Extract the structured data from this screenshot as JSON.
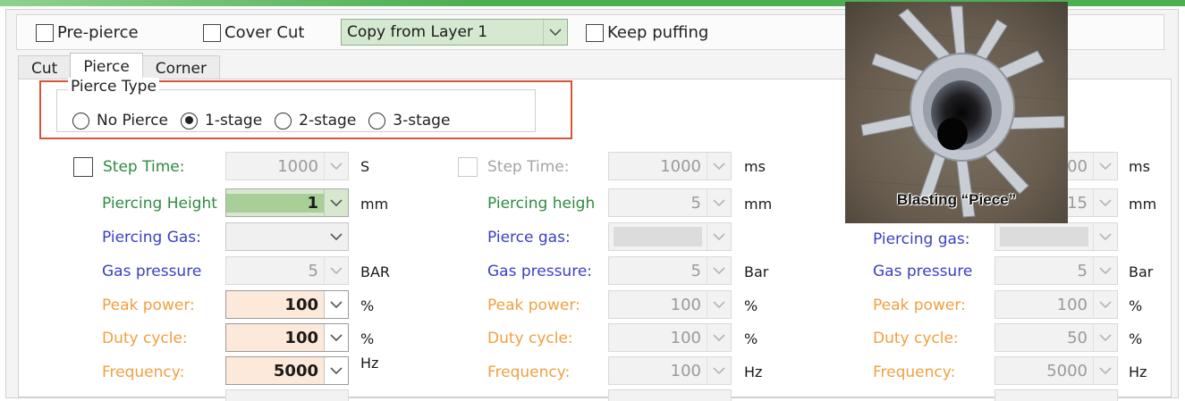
{
  "top_bar": {
    "pre_pierce_label": "Pre-pierce",
    "cover_cut_label": "Cover Cut",
    "copy_value": "Copy from Layer 1",
    "keep_puffing_label": "Keep puffing"
  },
  "tabs": [
    "Cut",
    "Pierce",
    "Corner"
  ],
  "active_tab": "Pierce",
  "pierce_type": {
    "title": "Pierce Type",
    "options": [
      "No Pierce",
      "1-stage",
      "2-stage",
      "3-stage"
    ],
    "selected": "1-stage"
  },
  "stage1": {
    "step_time": {
      "label": "Step Time:",
      "value": "1000",
      "unit": "S"
    },
    "piercing_height": {
      "label": "Piercing Height",
      "value": "1",
      "unit": "mm"
    },
    "piercing_gas": {
      "label": "Piercing Gas:",
      "value": ""
    },
    "gas_pressure": {
      "label": "Gas pressure",
      "value": "5",
      "unit": "BAR"
    },
    "peak_power": {
      "label": "Peak power:",
      "value": "100",
      "unit": "%"
    },
    "duty_cycle": {
      "label": "Duty cycle:",
      "value": "100",
      "unit": "%"
    },
    "frequency": {
      "label": "Frequency:",
      "value": "5000",
      "unit": "Hz"
    }
  },
  "stage2": {
    "step_time": {
      "label": "Step Time:",
      "value": "1000",
      "unit": "ms"
    },
    "piercing_height": {
      "label": "Piercing heigh",
      "value": "5",
      "unit": "mm"
    },
    "piercing_gas": {
      "label": "Pierce gas:",
      "value": ""
    },
    "gas_pressure": {
      "label": "Gas pressure:",
      "value": "5",
      "unit": "Bar"
    },
    "peak_power": {
      "label": "Peak power:",
      "value": "100",
      "unit": "%"
    },
    "duty_cycle": {
      "label": "Duty cycle:",
      "value": "100",
      "unit": "%"
    },
    "frequency": {
      "label": "Frequency:",
      "value": "100",
      "unit": "Hz"
    }
  },
  "stage3": {
    "step_time": {
      "value": "00",
      "unit": "ms"
    },
    "piercing_height": {
      "value": "15",
      "unit": "mm"
    },
    "piercing_gas": {
      "label": "Piercing gas:",
      "value": ""
    },
    "gas_pressure": {
      "label": "Gas pressure",
      "value": "5",
      "unit": "Bar"
    },
    "peak_power": {
      "label": "Peak power:",
      "value": "100",
      "unit": "%"
    },
    "duty_cycle": {
      "label": "Duty cycle:",
      "value": "50",
      "unit": "%"
    },
    "frequency": {
      "label": "Frequency:",
      "value": "5000",
      "unit": "Hz"
    }
  },
  "overlay": {
    "caption": "Blasting “Piece”"
  },
  "colors": {
    "accent_green": "#4caf50",
    "highlight_red": "#d6553a",
    "label_green": "#2e8b3e",
    "label_blue": "#3b3fc4",
    "label_orange": "#f0a040",
    "field_green": "#a8cf98",
    "field_peach": "#fde9d9"
  }
}
